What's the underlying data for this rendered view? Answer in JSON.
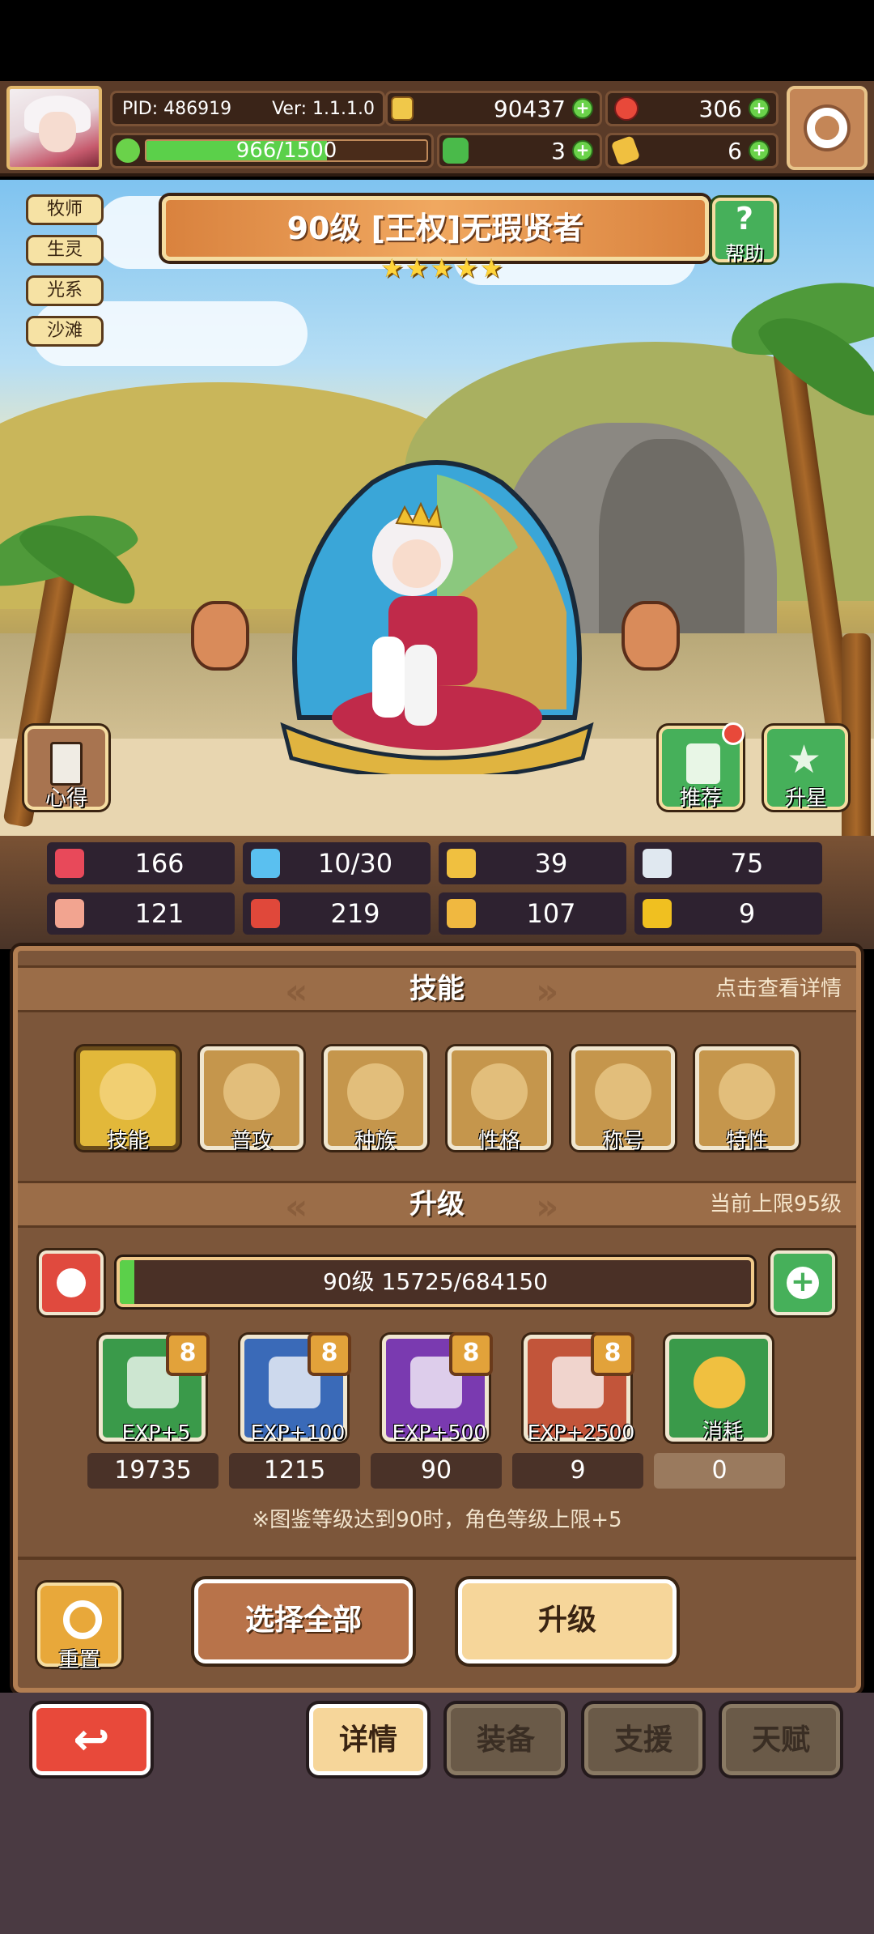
{
  "header": {
    "pid": "PID: 486919",
    "version": "Ver: 1.1.1.0",
    "gold": "90437",
    "gems": "306",
    "exp_progress": "966/1500",
    "exp_fraction": 0.644,
    "clover": "3",
    "ticket": "6"
  },
  "hero": {
    "title": "90级 [王权]无瑕贤者",
    "star_count": 5,
    "tags": [
      "牧师",
      "生灵",
      "光系",
      "沙滩"
    ],
    "help_label": "帮助",
    "insight_label": "心得",
    "recommend_label": "推荐",
    "starup_label": "升星"
  },
  "stats": [
    {
      "icon": "heart-icon",
      "value": "166",
      "color": "#e8495a"
    },
    {
      "icon": "drop-icon",
      "value": "10/30",
      "color": "#5ac0f0"
    },
    {
      "icon": "shield-icon",
      "value": "39",
      "color": "#f0c040"
    },
    {
      "icon": "wing-icon",
      "value": "75",
      "color": "#e0e8f0"
    },
    {
      "icon": "fist-icon",
      "value": "121",
      "color": "#f2a490"
    },
    {
      "icon": "book-icon",
      "value": "219",
      "color": "#e0483a"
    },
    {
      "icon": "boot-icon",
      "value": "107",
      "color": "#f0b840"
    },
    {
      "icon": "horseshoe-icon",
      "value": "9",
      "color": "#f0c020"
    }
  ],
  "skills_section": {
    "title": "技能",
    "note": "点击查看详情",
    "items": [
      "技能",
      "普攻",
      "种族",
      "性格",
      "称号",
      "特性"
    ]
  },
  "upgrade_section": {
    "title": "升级",
    "note": "当前上限95级",
    "progress_text": "90级  15725/684150",
    "progress_fraction": 0.023,
    "items": [
      {
        "label": "EXP+5",
        "badge": "8",
        "count": "19735",
        "color": "#3a9a4a"
      },
      {
        "label": "EXP+100",
        "badge": "8",
        "count": "1215",
        "color": "#3a6ab8"
      },
      {
        "label": "EXP+500",
        "badge": "8",
        "count": "90",
        "color": "#7a3ab0"
      },
      {
        "label": "EXP+2500",
        "badge": "8",
        "count": "9",
        "color": "#c2553a"
      },
      {
        "label": "消耗",
        "badge": "",
        "count": "0",
        "color": "#3a9a4a"
      }
    ],
    "note_text": "※图鉴等级达到90时，角色等级上限+5"
  },
  "actions": {
    "reset_label": "重置",
    "select_all_label": "选择全部",
    "upgrade_label": "升级"
  },
  "nav": {
    "details": "详情",
    "equipment": "装备",
    "support": "支援",
    "talent": "天赋"
  }
}
